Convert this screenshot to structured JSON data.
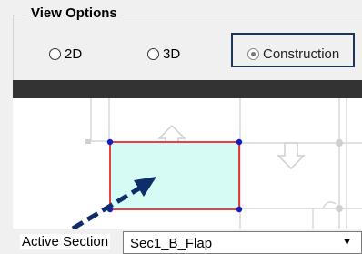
{
  "view_options": {
    "title": "View Options",
    "radios": [
      {
        "label": "2D",
        "checked": false
      },
      {
        "label": "3D",
        "checked": false
      },
      {
        "label": "Construction",
        "checked": true
      }
    ]
  },
  "active_section": {
    "label": "Active Section",
    "selected_value": "Sec1_B_Flap"
  },
  "colors": {
    "header_bar": "#333333",
    "section_fill": "#d6faf4",
    "section_border": "#e8000d",
    "vertex": "#1a1ab8",
    "arrow": "#0d2d6b"
  }
}
